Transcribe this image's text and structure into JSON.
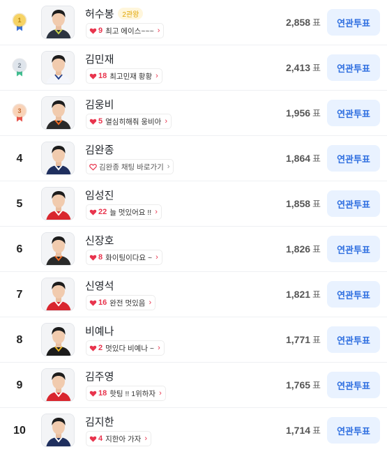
{
  "unit_label": "표",
  "vote_label": "연관투표",
  "colors": {
    "accent": "#2f6fe0",
    "heart": "#e8344d",
    "gold": "#f2c94c",
    "silver": "#b9c4d1",
    "bronze": "#f2b48a"
  },
  "players": [
    {
      "rank": "1",
      "medal": "gold",
      "name": "허수봉",
      "badge": "2관왕",
      "comment_type": "heart",
      "count": "9",
      "comment": "최고 에이스~~~",
      "votes": "2,858",
      "kit": "#2c3440",
      "trim": "#c8d24a"
    },
    {
      "rank": "2",
      "medal": "silver",
      "name": "김민재",
      "badge": "",
      "comment_type": "heart",
      "count": "18",
      "comment": "최고민재 황황",
      "votes": "2,413",
      "kit": "#f4f6fb",
      "trim": "#23408a"
    },
    {
      "rank": "3",
      "medal": "bronze",
      "name": "김웅비",
      "badge": "",
      "comment_type": "heart",
      "count": "5",
      "comment": "열심히해줘 웅비아",
      "votes": "1,956",
      "kit": "#2a2a2a",
      "trim": "#f26a21"
    },
    {
      "rank": "4",
      "medal": "",
      "name": "김완종",
      "badge": "",
      "comment_type": "chat",
      "count": "",
      "comment": "김완종 채팅 바로가기",
      "votes": "1,864",
      "kit": "#1f2f5e",
      "trim": "#ffffff"
    },
    {
      "rank": "5",
      "medal": "",
      "name": "임성진",
      "badge": "",
      "comment_type": "heart",
      "count": "22",
      "comment": "늘 멋있어요 !!",
      "votes": "1,858",
      "kit": "#d9262e",
      "trim": "#ffffff"
    },
    {
      "rank": "6",
      "medal": "",
      "name": "신장호",
      "badge": "",
      "comment_type": "heart",
      "count": "8",
      "comment": "화이팅이다요 ~",
      "votes": "1,826",
      "kit": "#2a2a2a",
      "trim": "#f26a21"
    },
    {
      "rank": "7",
      "medal": "",
      "name": "신영석",
      "badge": "",
      "comment_type": "heart",
      "count": "16",
      "comment": "완전 멋있음",
      "votes": "1,821",
      "kit": "#d9262e",
      "trim": "#ffffff"
    },
    {
      "rank": "8",
      "medal": "",
      "name": "비예나",
      "badge": "",
      "comment_type": "heart",
      "count": "2",
      "comment": "멋있다 비예나 ~",
      "votes": "1,771",
      "kit": "#1c1c1c",
      "trim": "#e6b422"
    },
    {
      "rank": "9",
      "medal": "",
      "name": "김주영",
      "badge": "",
      "comment_type": "heart",
      "count": "18",
      "comment": "핫팅 !! 1위하자",
      "votes": "1,765",
      "kit": "#d9262e",
      "trim": "#ffffff"
    },
    {
      "rank": "10",
      "medal": "",
      "name": "김지한",
      "badge": "",
      "comment_type": "heart",
      "count": "4",
      "comment": "지한아 가자",
      "votes": "1,714",
      "kit": "#1f2f5e",
      "trim": "#ffffff"
    }
  ]
}
